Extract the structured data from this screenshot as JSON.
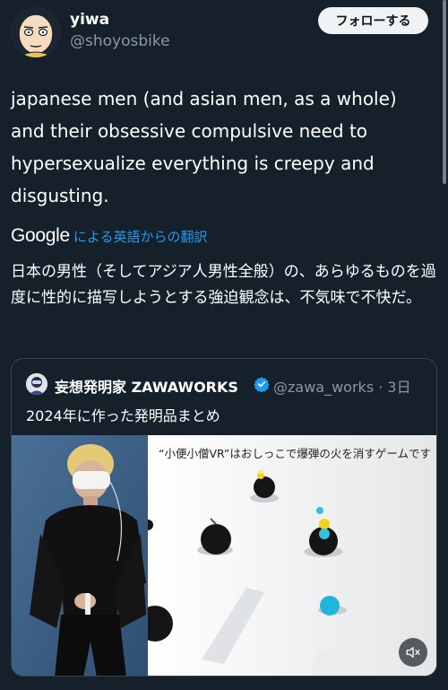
{
  "user": {
    "display_name": "yiwa",
    "handle": "@shoyosbike",
    "avatar_icon": "bald-cartoon-avatar"
  },
  "follow_button": "フォローする",
  "tweet": {
    "text": "japanese men (and asian men, as a whole) and their obsessive compulsive need to hypersexualize everything is creepy and disgusting.",
    "translation_provider": "Google",
    "translation_link": "による英語からの翻訳",
    "translated_text": "日本の男性（そしてアジア人男性全般）の、あらゆるものを過度に性的に描写しようとする強迫観念は、不気味で不快だ。"
  },
  "quote": {
    "display_name": "妄想発明家 ZAWAWORKS",
    "verified_icon": "verified-badge-icon",
    "handle_time": "@zawa_works · 3日",
    "text": "2024年に作った発明品まとめ",
    "media": {
      "caption": "“小便小僧VR”はおしっこで爆弾の火を消すゲームです",
      "mute_icon": "speaker-muted-icon"
    }
  },
  "colors": {
    "background": "#15202b",
    "accent": "#1d9bf0",
    "secondary_text": "#8b98a5"
  }
}
